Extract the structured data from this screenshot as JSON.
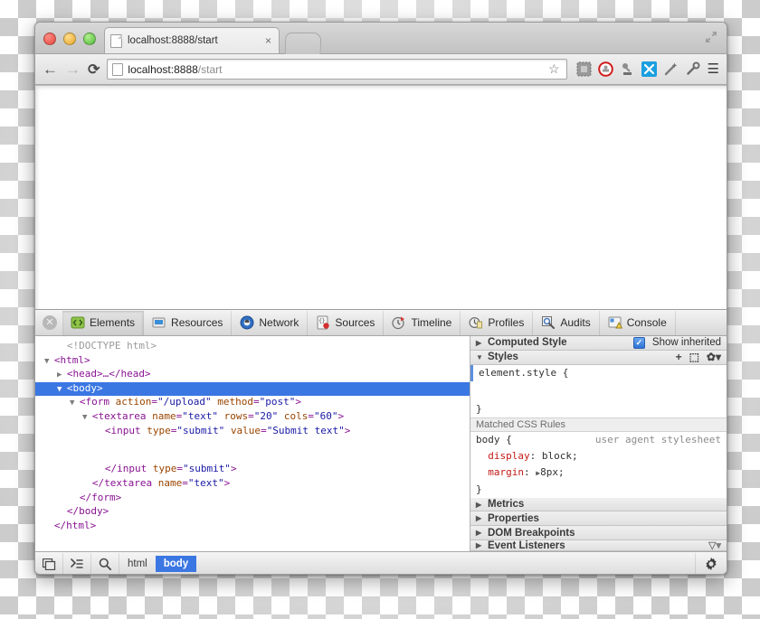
{
  "window": {
    "traffic_lights": [
      "close",
      "minimize",
      "zoom"
    ],
    "maximize_label": "⤢"
  },
  "tab": {
    "title": "localhost:8888/start",
    "close_label": "×",
    "favicon": "page-icon",
    "newtab_label": ""
  },
  "navbar": {
    "back_label": "←",
    "forward_label": "→",
    "reload_label": "⟳",
    "url_host": "localhost:8888",
    "url_path": "/start",
    "star_label": "☆",
    "menu_label": "☰",
    "extensions": [
      {
        "name": "evernote-icon"
      },
      {
        "name": "adblock-icon"
      },
      {
        "name": "stamp-icon"
      },
      {
        "name": "xmarks-icon"
      },
      {
        "name": "wand-icon"
      },
      {
        "name": "key-icon"
      }
    ]
  },
  "devtools": {
    "close_label": "✕",
    "tabs": [
      {
        "label": "Elements",
        "icon": "elements-icon",
        "active": true
      },
      {
        "label": "Resources",
        "icon": "resources-icon",
        "active": false
      },
      {
        "label": "Network",
        "icon": "network-icon",
        "active": false
      },
      {
        "label": "Sources",
        "icon": "sources-icon",
        "active": false
      },
      {
        "label": "Timeline",
        "icon": "timeline-icon",
        "active": false
      },
      {
        "label": "Profiles",
        "icon": "profiles-icon",
        "active": false
      },
      {
        "label": "Audits",
        "icon": "audits-icon",
        "active": false
      },
      {
        "label": "Console",
        "icon": "console-icon",
        "active": false
      }
    ],
    "dom_tree": [
      {
        "indent": 1,
        "twisty": "",
        "text": "<!DOCTYPE html>",
        "kind": "doctype",
        "selected": false
      },
      {
        "indent": 0,
        "twisty": "▼",
        "text": "<html>",
        "kind": "tag",
        "selected": false
      },
      {
        "indent": 1,
        "twisty": "▶",
        "text": "<head>…</head>",
        "kind": "tag",
        "selected": false
      },
      {
        "indent": 1,
        "twisty": "▼",
        "text": "<body>",
        "kind": "tag",
        "selected": true
      },
      {
        "indent": 2,
        "twisty": "▼",
        "text": "<form action=\"/upload\" method=\"post\">",
        "kind": "tag",
        "selected": false
      },
      {
        "indent": 3,
        "twisty": "▼",
        "text": "<textarea name=\"text\" rows=\"20\" cols=\"60\">",
        "kind": "tag",
        "selected": false
      },
      {
        "indent": 4,
        "twisty": "",
        "text": "<input type=\"submit\" value=\"Submit text\">",
        "kind": "tag",
        "selected": false
      },
      {
        "indent": 0,
        "twisty": "",
        "text": "",
        "kind": "blank",
        "selected": false
      },
      {
        "indent": 0,
        "twisty": "",
        "text": "",
        "kind": "blank",
        "selected": false
      },
      {
        "indent": 4,
        "twisty": "",
        "text": "</input type=\"submit\">",
        "kind": "tag",
        "selected": false
      },
      {
        "indent": 3,
        "twisty": "",
        "text": "</textarea name=\"text\">",
        "kind": "tag",
        "selected": false
      },
      {
        "indent": 2,
        "twisty": "",
        "text": "</form>",
        "kind": "tag",
        "selected": false
      },
      {
        "indent": 1,
        "twisty": "",
        "text": "</body>",
        "kind": "tag",
        "selected": false
      },
      {
        "indent": 0,
        "twisty": "",
        "text": "</html>",
        "kind": "tag",
        "selected": false
      }
    ],
    "sidebar": {
      "computed_style_label": "Computed Style",
      "show_inherited_label": "Show inherited",
      "show_inherited_checked": true,
      "styles_label": "Styles",
      "add_rule_label": "+",
      "element_state_label": "⬚",
      "settings_label": "✿▾",
      "element_style_open": "element.style {",
      "element_style_close": "}",
      "matched_rules_label": "Matched CSS Rules",
      "rule_selector": "body {",
      "rule_source": "user agent stylesheet",
      "rule_props": [
        {
          "name": "display",
          "value": "block;",
          "expandable": false
        },
        {
          "name": "margin",
          "value": "8px;",
          "expandable": true
        }
      ],
      "rule_close": "}",
      "sections": [
        {
          "label": "Metrics"
        },
        {
          "label": "Properties"
        },
        {
          "label": "DOM Breakpoints"
        },
        {
          "label": "Event Listeners"
        }
      ]
    },
    "statusbar": {
      "dock_label": "◰",
      "console_drawer_label": "≫",
      "search_label": "🔍",
      "breadcrumbs": [
        {
          "label": "html",
          "active": false
        },
        {
          "label": "body",
          "active": true
        }
      ],
      "settings_label": "⚙"
    }
  }
}
